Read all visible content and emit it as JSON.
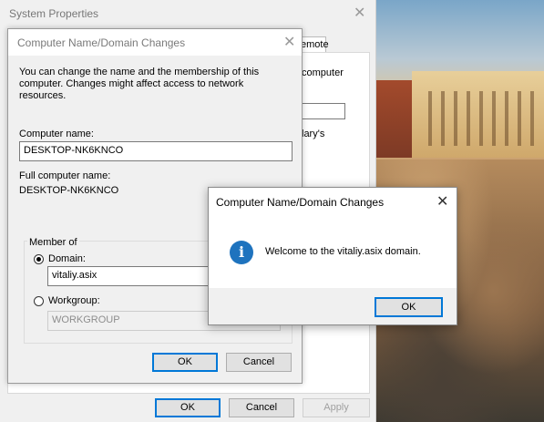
{
  "system_properties": {
    "title": "System Properties",
    "close_glyph": "✕",
    "tab_fragment": "emote",
    "text_fragment_1": "computer",
    "text_fragment_2": "lary's",
    "buttons": {
      "ok": "OK",
      "cancel": "Cancel",
      "apply": "Apply"
    }
  },
  "name_change_dialog": {
    "title": "Computer Name/Domain Changes",
    "close_glyph": "✕",
    "description": "You can change the name and the membership of this computer. Changes might affect access to network resources.",
    "computer_name_label": "Computer name:",
    "computer_name_value": "DESKTOP-NK6KNCO",
    "full_name_label": "Full computer name:",
    "full_name_value": "DESKTOP-NK6KNCO",
    "member_of_label": "Member of",
    "domain_label": "Domain:",
    "domain_value": "vitaliy.asix",
    "workgroup_label": "Workgroup:",
    "workgroup_value": "WORKGROUP",
    "selected_membership": "domain",
    "buttons": {
      "ok": "OK",
      "cancel": "Cancel"
    }
  },
  "welcome_message": {
    "title": "Computer Name/Domain Changes",
    "close_glyph": "✕",
    "icon": "info-icon",
    "icon_glyph": "i",
    "message": "Welcome to the vitaliy.asix domain.",
    "ok_label": "OK"
  },
  "colors": {
    "accent": "#0078d7",
    "info_icon": "#1e73be",
    "dialog_bg": "#f0f0f0"
  }
}
